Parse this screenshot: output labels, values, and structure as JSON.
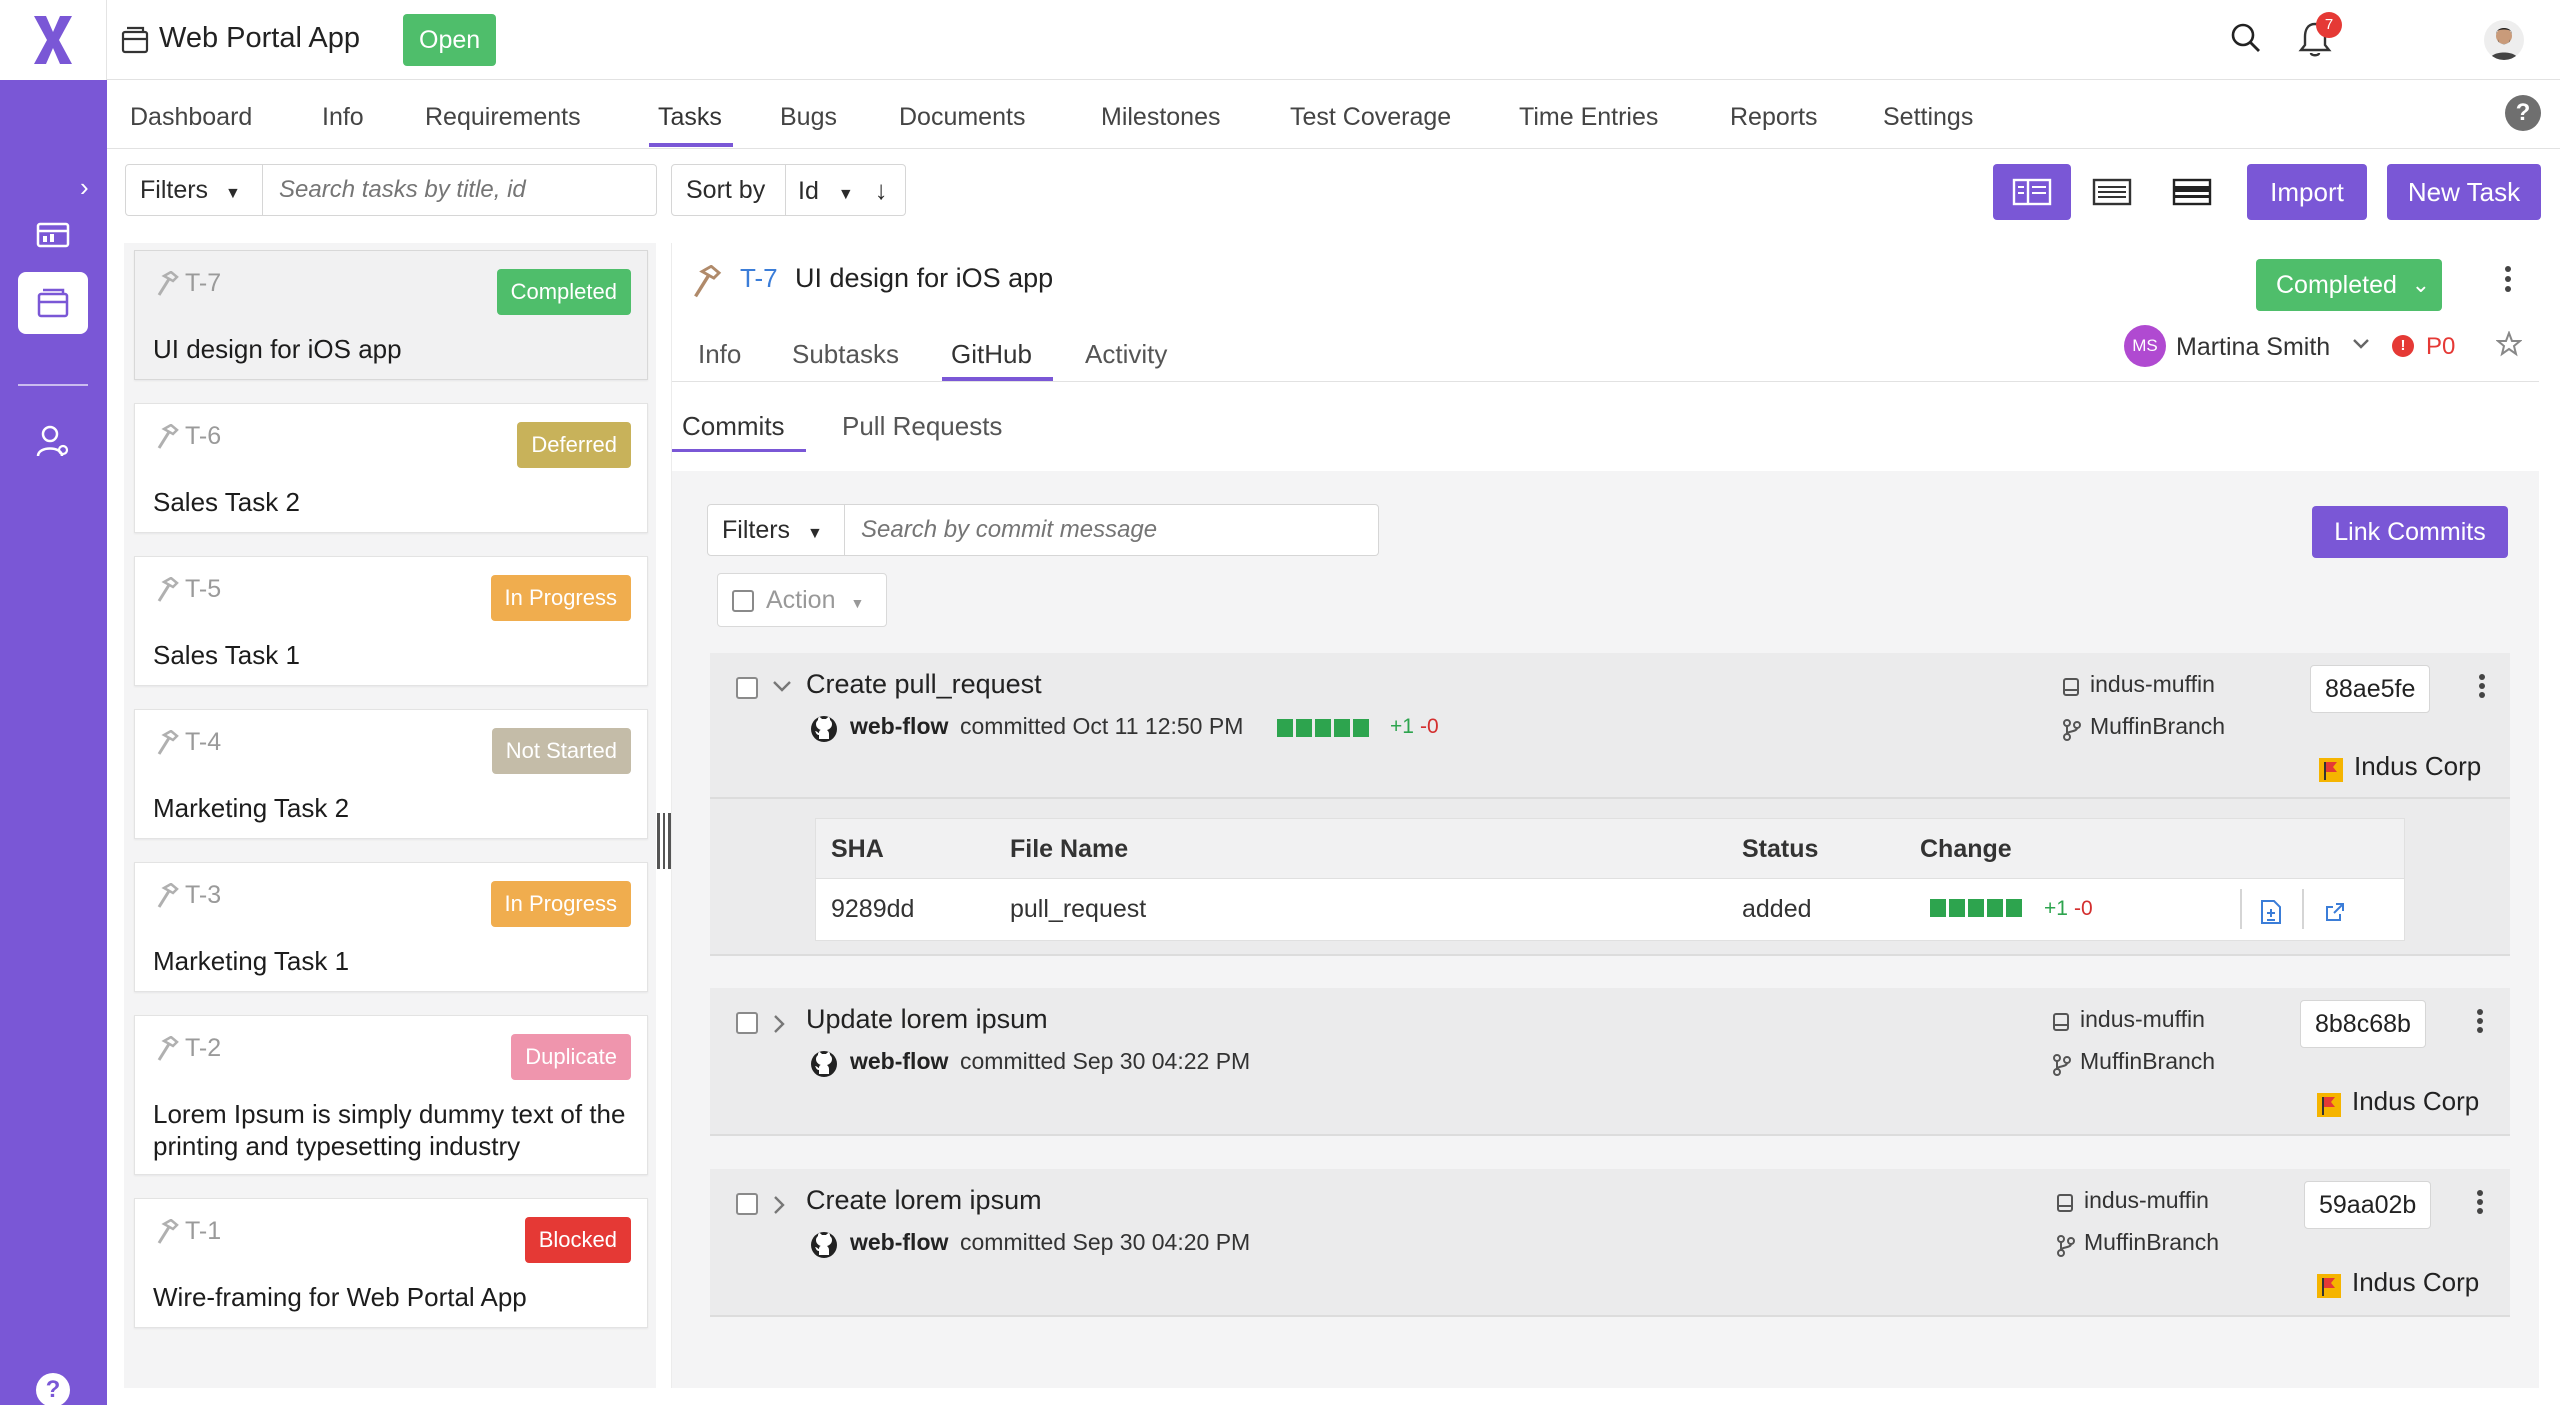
{
  "app": {
    "title": "Web Portal App",
    "status": "Open",
    "notification_count": "7",
    "colors": {
      "accent": "#7a57d6",
      "success": "#4fbe6b",
      "link": "#3b7dd8",
      "danger": "#e53935"
    }
  },
  "nav": {
    "tabs": [
      {
        "label": "Dashboard"
      },
      {
        "label": "Info"
      },
      {
        "label": "Requirements"
      },
      {
        "label": "Tasks"
      },
      {
        "label": "Bugs"
      },
      {
        "label": "Documents"
      },
      {
        "label": "Milestones"
      },
      {
        "label": "Test Coverage"
      },
      {
        "label": "Time Entries"
      },
      {
        "label": "Reports"
      },
      {
        "label": "Settings"
      }
    ],
    "active": "Tasks"
  },
  "toolbar": {
    "filters_label": "Filters",
    "search_placeholder": "Search tasks by title, id",
    "sort_label": "Sort by",
    "sort_value": "Id",
    "import_label": "Import",
    "new_task_label": "New Task"
  },
  "tasks": [
    {
      "id": "T-7",
      "status": "Completed",
      "status_color": "#4fbe6b",
      "title": "UI design for iOS app"
    },
    {
      "id": "T-6",
      "status": "Deferred",
      "status_color": "#c8b25a",
      "title": "Sales Task 2"
    },
    {
      "id": "T-5",
      "status": "In Progress",
      "status_color": "#f0ad4e",
      "title": "Sales Task 1"
    },
    {
      "id": "T-4",
      "status": "Not Started",
      "status_color": "#c4bca8",
      "title": "Marketing Task 2"
    },
    {
      "id": "T-3",
      "status": "In Progress",
      "status_color": "#f0ad4e",
      "title": "Marketing Task 1"
    },
    {
      "id": "T-2",
      "status": "Duplicate",
      "status_color": "#ef95ad",
      "title": "Lorem Ipsum is simply dummy text of the printing and typesetting industry"
    },
    {
      "id": "T-1",
      "status": "Blocked",
      "status_color": "#e53935",
      "title": "Wire-framing for Web Portal App"
    }
  ],
  "detail": {
    "id": "T-7",
    "title": "UI design for iOS app",
    "status": "Completed",
    "tabs": [
      {
        "label": "Info"
      },
      {
        "label": "Subtasks"
      },
      {
        "label": "GitHub"
      },
      {
        "label": "Activity"
      }
    ],
    "active_tab": "GitHub",
    "assignee_initials": "MS",
    "assignee": "Martina Smith",
    "priority": "P0",
    "sub_tabs": [
      {
        "label": "Commits"
      },
      {
        "label": "Pull Requests"
      }
    ],
    "active_sub_tab": "Commits"
  },
  "commits": {
    "filters_label": "Filters",
    "search_placeholder": "Search by commit message",
    "link_label": "Link Commits",
    "action_label": "Action",
    "items": [
      {
        "message": "Create pull_request",
        "author": "web-flow",
        "date": "committed Oct 11 12:50 PM",
        "additions": "+1",
        "deletions": "-0",
        "repo": "indus-muffin",
        "branch": "MuffinBranch",
        "sha": "88ae5fe",
        "org": "Indus Corp",
        "expanded": true
      },
      {
        "message": "Update lorem ipsum",
        "author": "web-flow",
        "date": "committed Sep 30 04:22 PM",
        "repo": "indus-muffin",
        "branch": "MuffinBranch",
        "sha": "8b8c68b",
        "org": "Indus Corp",
        "expanded": false
      },
      {
        "message": "Create lorem ipsum",
        "author": "web-flow",
        "date": "committed Sep 30 04:20 PM",
        "repo": "indus-muffin",
        "branch": "MuffinBranch",
        "sha": "59aa02b",
        "org": "Indus Corp",
        "expanded": false
      }
    ],
    "files": {
      "headers": {
        "sha": "SHA",
        "file_name": "File Name",
        "status": "Status",
        "change": "Change"
      },
      "rows": [
        {
          "sha": "9289dd",
          "file_name": "pull_request",
          "status": "added",
          "additions": "+1",
          "deletions": "-0"
        }
      ]
    }
  }
}
